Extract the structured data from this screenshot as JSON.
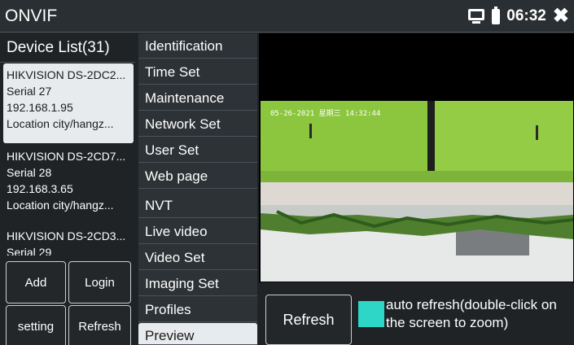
{
  "app_title": "ONVIF",
  "status": {
    "time": "06:32",
    "icons": [
      "monitor-icon",
      "battery-icon",
      "close-icon"
    ]
  },
  "device_list": {
    "header": "Device List(31)",
    "devices": [
      {
        "name": "HIKVISION DS-2DC2...",
        "serial": "Serial  27",
        "ip": "192.168.1.95",
        "location": "Location  city/hangz..."
      },
      {
        "name": "HIKVISION DS-2CD7...",
        "serial": "Serial  28",
        "ip": "192.168.3.65",
        "location": "Location  city/hangz..."
      },
      {
        "name": "HIKVISION DS-2CD3...",
        "serial": "Serial  29"
      }
    ]
  },
  "buttons": {
    "add": "Add",
    "login": "Login",
    "setting": "setting",
    "refresh": "Refresh"
  },
  "menu": {
    "items": [
      "Identification",
      "Time Set",
      "Maintenance",
      "Network Set",
      "User Set",
      "Web page",
      "NVT",
      "Live video",
      "Video Set",
      "Imaging Set",
      "Profiles",
      "Preview"
    ],
    "selected": "Preview"
  },
  "video": {
    "osd": "05-26-2021 星期三 14:32:44"
  },
  "preview_controls": {
    "refresh": "Refresh",
    "auto_refresh_label": "auto refresh(double-click on the screen to zoom)",
    "checkbox_color": "#2ed6c8"
  }
}
